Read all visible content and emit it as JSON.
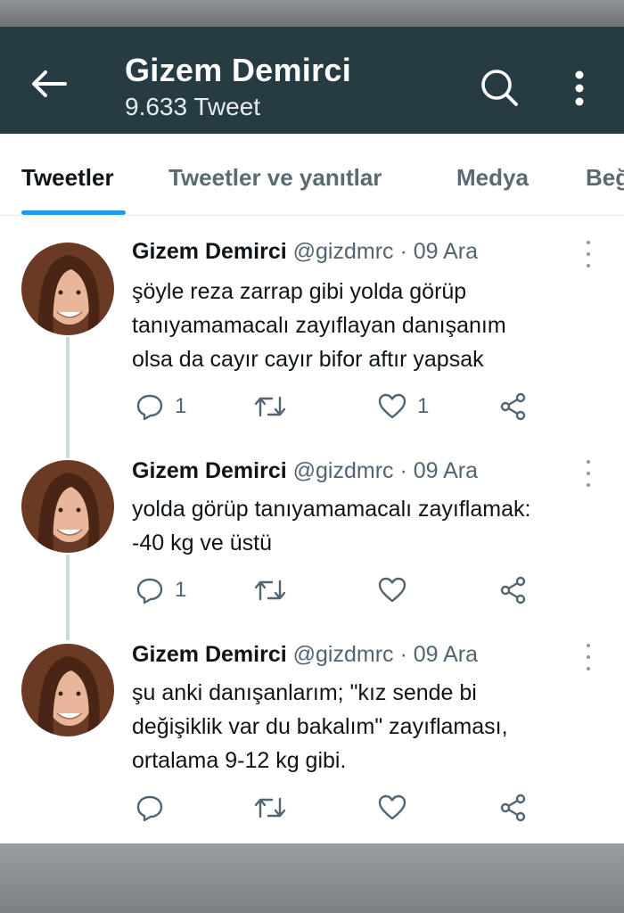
{
  "header": {
    "name": "Gizem Demirci",
    "tweet_count": "9.633 Tweet",
    "back_icon": "arrow-left-icon",
    "search_icon": "search-icon",
    "more_icon": "more-vertical-icon",
    "bg_color": "#263b42"
  },
  "tabs": [
    {
      "label": "Tweetler",
      "active": true
    },
    {
      "label": "Tweetler ve yanıtlar",
      "active": false
    },
    {
      "label": "Medya",
      "active": false
    },
    {
      "label": "Beğ",
      "active": false
    }
  ],
  "accent_color": "#1d9bf0",
  "tweets": [
    {
      "name": "Gizem Demirci",
      "handle": "@gizdmrc",
      "date": "· 09 Ara",
      "lines": [
        "şöyle reza zarrap gibi yolda görüp",
        "tanıyamamacalı zayıflayan danışanım",
        "olsa da cayır cayır bifor aftır yapsak"
      ],
      "replies": "1",
      "retweets": "",
      "likes": "1"
    },
    {
      "name": "Gizem Demirci",
      "handle": "@gizdmrc",
      "date": "· 09 Ara",
      "lines": [
        "yolda görüp tanıyamamacalı zayıflamak:",
        "-40 kg ve üstü"
      ],
      "replies": "1",
      "retweets": "",
      "likes": ""
    },
    {
      "name": "Gizem Demirci",
      "handle": "@gizdmrc",
      "date": "· 09 Ara",
      "lines": [
        "şu anki danışanlarım; \"kız sende bi",
        "değişiklik var du bakalım\" zayıflaması,",
        "ortalama 9-12 kg gibi."
      ],
      "replies": "",
      "retweets": "",
      "likes": ""
    }
  ]
}
